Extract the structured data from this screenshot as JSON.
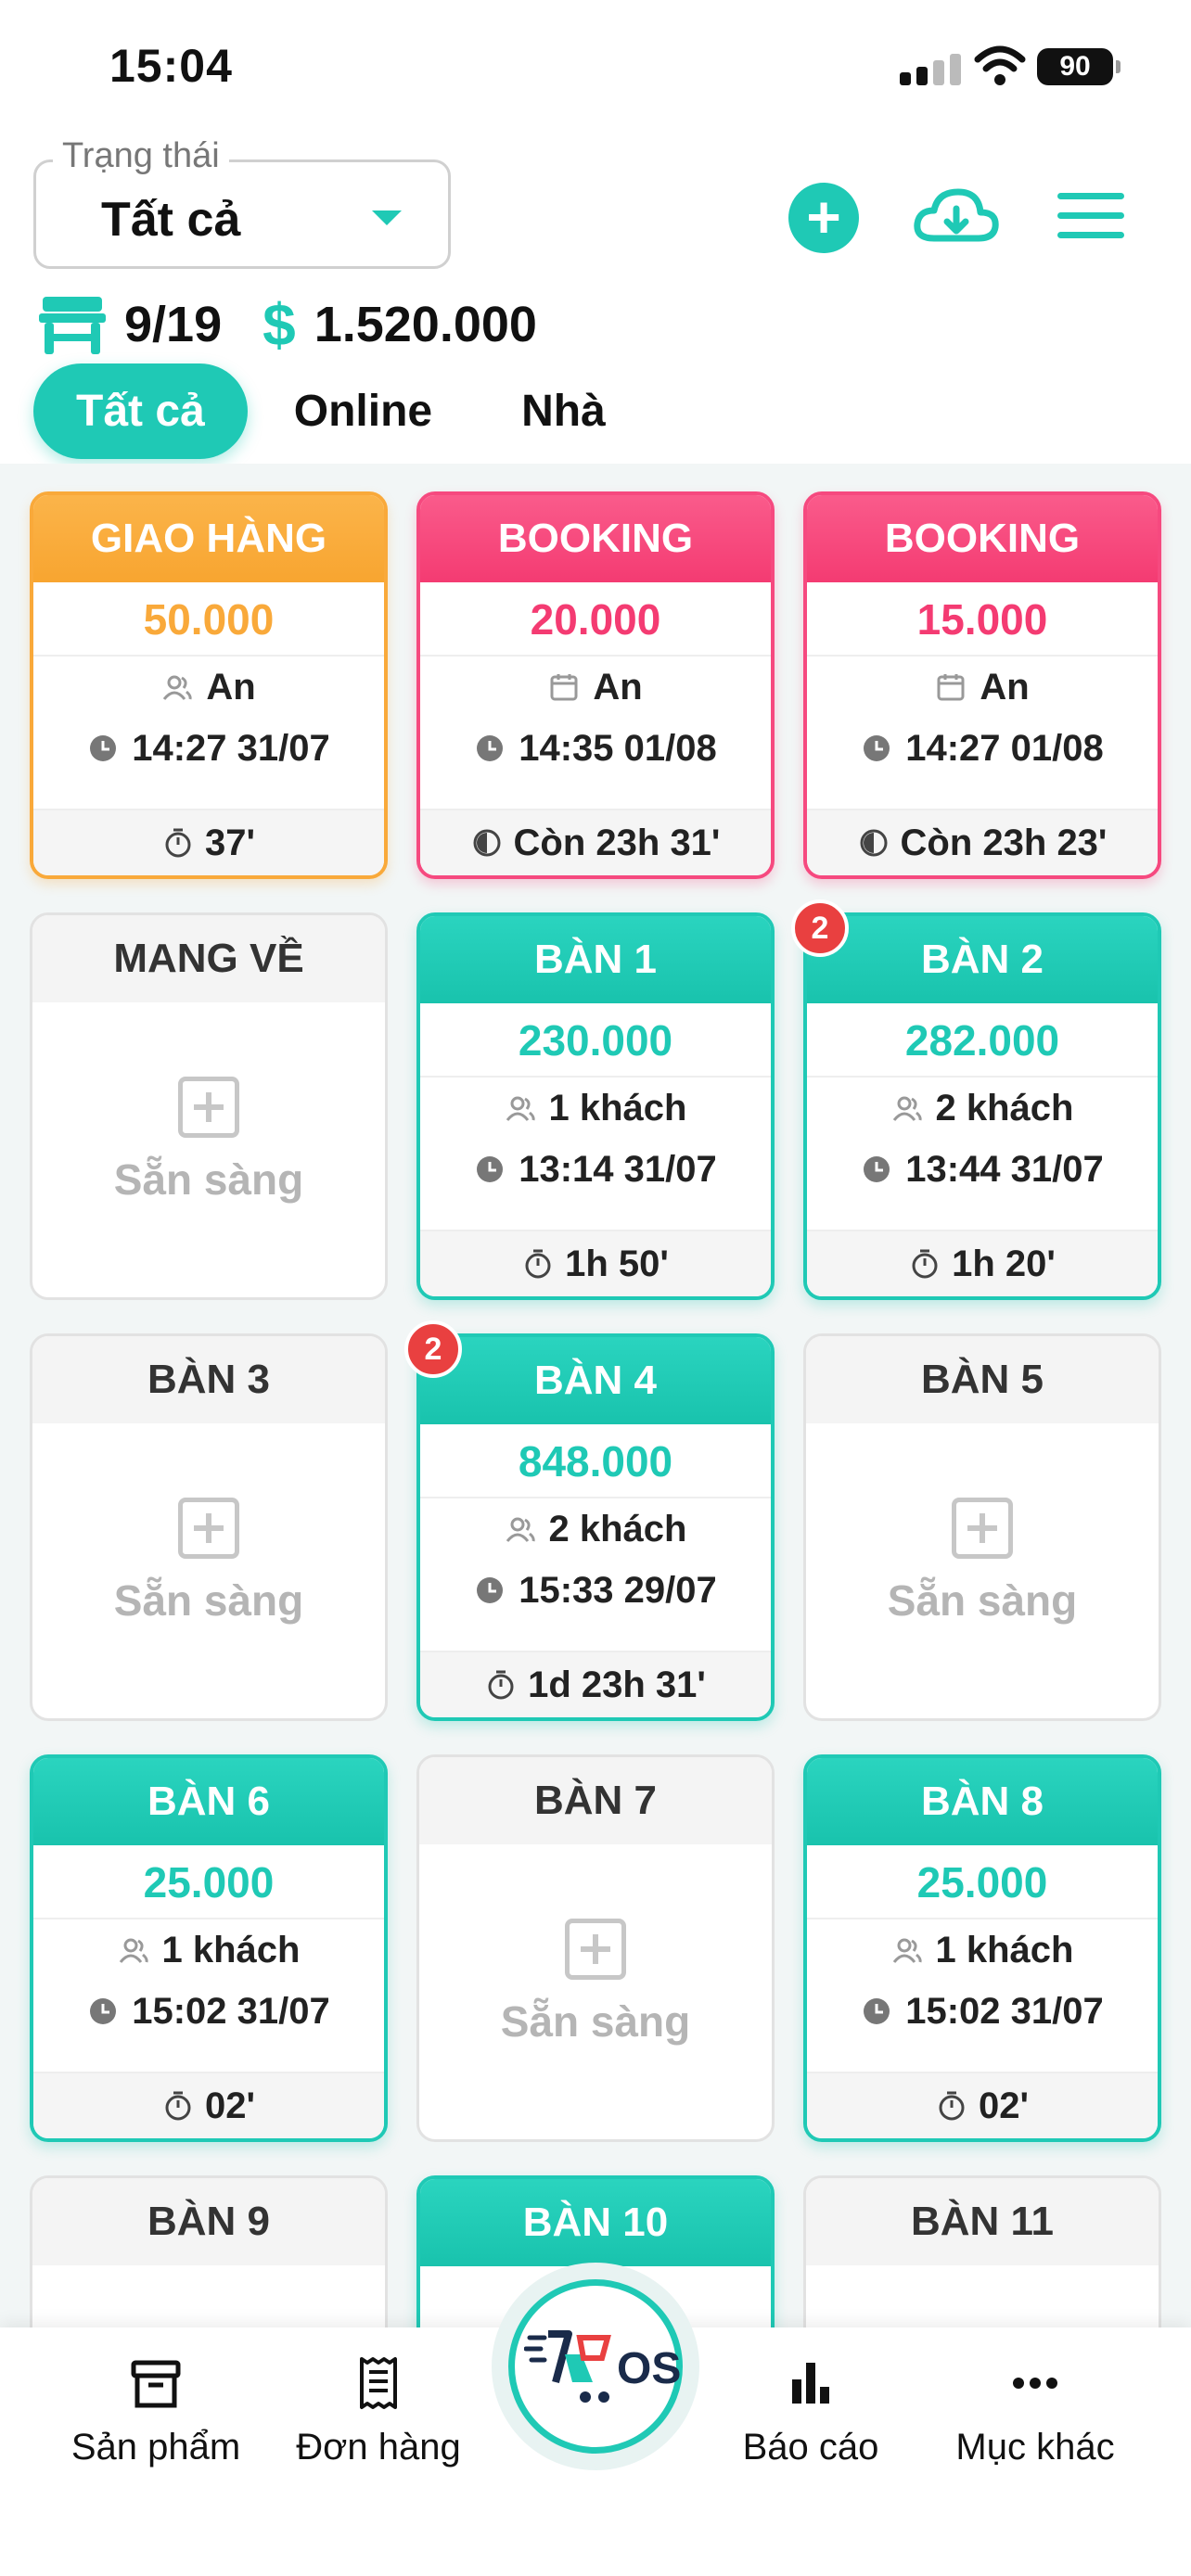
{
  "status_bar": {
    "time": "15:04",
    "battery": "90"
  },
  "filter": {
    "label": "Trạng thái",
    "value": "Tất cả"
  },
  "summary": {
    "tables": "9/19",
    "currency_symbol": "$",
    "total": "1.520.000"
  },
  "tabs": [
    {
      "label": "Tất cả",
      "active": true
    },
    {
      "label": "Online"
    },
    {
      "label": "Nhà"
    }
  ],
  "cards": [
    {
      "title": "GIAO HÀNG",
      "amount": "50.000",
      "line1": "An",
      "line1_icon": "user-icon",
      "line2": "14:27 31/07",
      "footer": "37'",
      "footer_icon": "stopwatch-icon",
      "color": "#f9a93a"
    },
    {
      "title": "BOOKING",
      "amount": "20.000",
      "line1": "An",
      "line1_icon": "calendar-icon",
      "line2": "14:35 01/08",
      "footer": "Còn 23h 31'",
      "footer_icon": "countdown-icon",
      "color": "#f43b72"
    },
    {
      "title": "BOOKING",
      "amount": "15.000",
      "line1": "An",
      "line1_icon": "calendar-icon",
      "line2": "14:27 01/08",
      "footer": "Còn 23h 23'",
      "footer_icon": "countdown-icon",
      "color": "#f43b72"
    },
    {
      "title": "MANG VỀ",
      "ready": "Sẵn sàng"
    },
    {
      "title": "BÀN 1",
      "amount": "230.000",
      "line1": "1 khách",
      "line2": "13:14 31/07",
      "footer": "1h 50'"
    },
    {
      "title": "BÀN 2",
      "badge": "2",
      "amount": "282.000",
      "line1": "2 khách",
      "line2": "13:44 31/07",
      "footer": "1h 20'"
    },
    {
      "title": "BÀN 3",
      "ready": "Sẵn sàng"
    },
    {
      "title": "BÀN 4",
      "badge": "2",
      "amount": "848.000",
      "line1": "2 khách",
      "line2": "15:33 29/07",
      "footer": "1d 23h 31'"
    },
    {
      "title": "BÀN 5",
      "ready": "Sẵn sàng"
    },
    {
      "title": "BÀN 6",
      "amount": "25.000",
      "line1": "1 khách",
      "line2": "15:02 31/07",
      "footer": "02'"
    },
    {
      "title": "BÀN 7",
      "ready": "Sẵn sàng"
    },
    {
      "title": "BÀN 8",
      "amount": "25.000",
      "line1": "1 khách",
      "line2": "15:02 31/07",
      "footer": "02'"
    },
    {
      "title": "BÀN 9"
    },
    {
      "title": "BÀN 10"
    },
    {
      "title": "BÀN 11"
    }
  ],
  "bottom_nav": [
    {
      "label": "Sản phẩm",
      "icon": "archive-box-icon"
    },
    {
      "label": "Đơn hàng",
      "icon": "receipt-icon"
    },
    {
      "label": "Báo cáo",
      "icon": "bar-chart-icon"
    },
    {
      "label": "Mục khác",
      "icon": "more-dots-icon"
    }
  ],
  "logo": {
    "text": "OS"
  },
  "colors": {
    "accent": "#1fc9b5",
    "delivery": "#f9a93a",
    "booking": "#f43b72",
    "badge": "#e94040"
  }
}
